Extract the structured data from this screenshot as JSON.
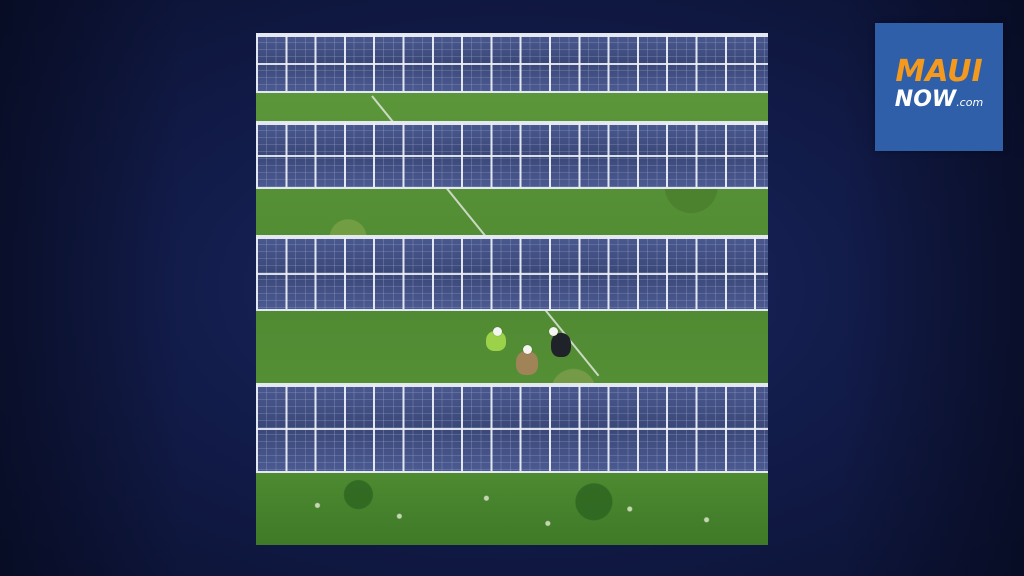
{
  "logo": {
    "brand_primary": "MAUI",
    "brand_secondary": "NOW",
    "brand_suffix": ".com",
    "background_color": "#2f5fa8",
    "primary_color": "#f39a1e",
    "secondary_color": "#ffffff"
  },
  "background": {
    "color": "#131d4c"
  },
  "photo": {
    "subject": "aerial-solar-farm-with-workers",
    "panel_rows": 4,
    "workers": 3
  }
}
